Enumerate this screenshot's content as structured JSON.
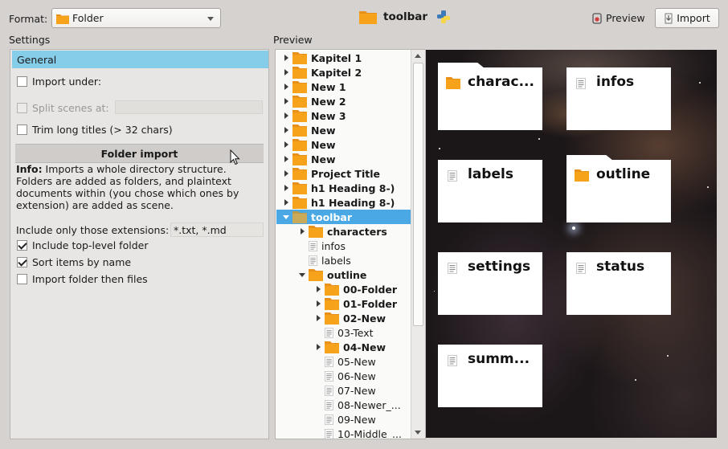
{
  "top_bar": {
    "format_label": "Format:",
    "format_value": "Folder",
    "title": "toolbar",
    "preview_label": "Preview",
    "import_label": "Import"
  },
  "headings": {
    "settings": "Settings",
    "preview": "Preview"
  },
  "settings": {
    "group": "General",
    "import_under": "Import under:",
    "split_scenes": "Split scenes at:",
    "trim_titles": "Trim long titles (> 32 chars)",
    "folder_import": "Folder import",
    "info_label": "Info:",
    "info_text": " Imports a whole directory structure. Folders are added as folders, and plaintext documents within (you chose which ones by extension) are added as scene.",
    "ext_label": "Include only those extensions:",
    "ext_value": "*.txt, *.md",
    "include_top": "Include top-level folder",
    "sort_items": "Sort items by name",
    "folder_then_files": "Import folder then files"
  },
  "tree": [
    {
      "name": "Kapitel 1",
      "type": "folder",
      "level": 0,
      "arrow": "right"
    },
    {
      "name": "Kapitel 2",
      "type": "folder",
      "level": 0,
      "arrow": "right"
    },
    {
      "name": "New 1",
      "type": "folder",
      "level": 0,
      "arrow": "right"
    },
    {
      "name": "New 2",
      "type": "folder",
      "level": 0,
      "arrow": "right"
    },
    {
      "name": "New 3",
      "type": "folder",
      "level": 0,
      "arrow": "right"
    },
    {
      "name": "New",
      "type": "folder",
      "level": 0,
      "arrow": "right"
    },
    {
      "name": "New",
      "type": "folder",
      "level": 0,
      "arrow": "right"
    },
    {
      "name": "New",
      "type": "folder",
      "level": 0,
      "arrow": "right"
    },
    {
      "name": "Project Title",
      "type": "folder",
      "level": 0,
      "arrow": "right"
    },
    {
      "name": "h1 Heading 8-)",
      "type": "folder",
      "level": 0,
      "arrow": "right"
    },
    {
      "name": "h1 Heading 8-)",
      "type": "folder",
      "level": 0,
      "arrow": "right"
    },
    {
      "name": "toolbar",
      "type": "folder",
      "level": 0,
      "arrow": "down",
      "selected": true
    },
    {
      "name": "characters",
      "type": "folder",
      "level": 1,
      "arrow": "right"
    },
    {
      "name": "infos",
      "type": "text",
      "level": 1,
      "arrow": ""
    },
    {
      "name": "labels",
      "type": "text",
      "level": 1,
      "arrow": ""
    },
    {
      "name": "outline",
      "type": "folder",
      "level": 1,
      "arrow": "down"
    },
    {
      "name": "00-Folder",
      "type": "folder",
      "level": 2,
      "arrow": "right"
    },
    {
      "name": "01-Folder",
      "type": "folder",
      "level": 2,
      "arrow": "right"
    },
    {
      "name": "02-New",
      "type": "folder",
      "level": 2,
      "arrow": "right"
    },
    {
      "name": "03-Text",
      "type": "text",
      "level": 2,
      "arrow": ""
    },
    {
      "name": "04-New",
      "type": "folder",
      "level": 2,
      "arrow": "right"
    },
    {
      "name": "05-New",
      "type": "text",
      "level": 2,
      "arrow": ""
    },
    {
      "name": "06-New",
      "type": "text",
      "level": 2,
      "arrow": ""
    },
    {
      "name": "07-New",
      "type": "text",
      "level": 2,
      "arrow": ""
    },
    {
      "name": "08-Newer_...",
      "type": "text",
      "level": 2,
      "arrow": ""
    },
    {
      "name": "09-New",
      "type": "text",
      "level": 2,
      "arrow": ""
    },
    {
      "name": "10-Middle_...",
      "type": "text",
      "level": 2,
      "arrow": ""
    }
  ],
  "cards": [
    {
      "title": "charac...",
      "type": "folder"
    },
    {
      "title": "infos",
      "type": "text"
    },
    {
      "title": "labels",
      "type": "text"
    },
    {
      "title": "outline",
      "type": "folder"
    },
    {
      "title": "settings",
      "type": "text"
    },
    {
      "title": "status",
      "type": "text"
    },
    {
      "title": "summ...",
      "type": "text"
    }
  ],
  "colors": {
    "folder": "#f7a21b",
    "selection": "#4aa8e4",
    "settings_header": "#86cdea"
  }
}
